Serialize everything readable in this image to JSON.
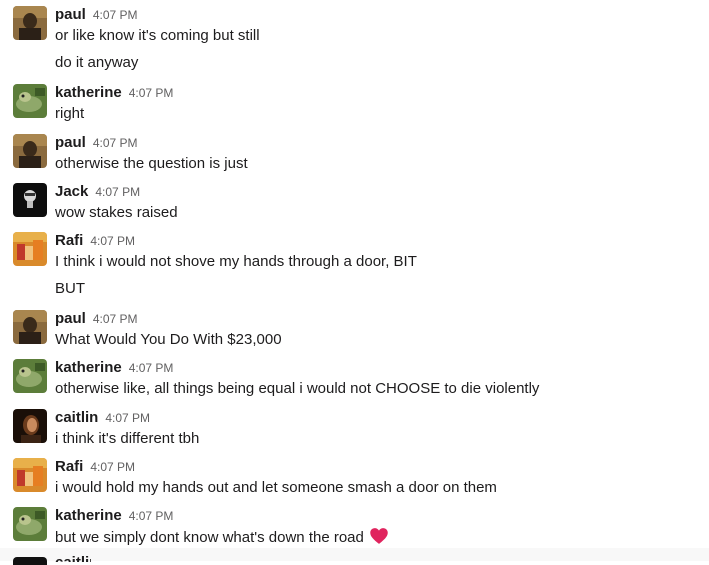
{
  "messages": [
    {
      "author": "paul",
      "time": "4:07 PM",
      "text": "or like know it's coming but still"
    },
    {
      "text": "do it anyway"
    },
    {
      "author": "katherine",
      "time": "4:07 PM",
      "text": "right"
    },
    {
      "author": "paul",
      "time": "4:07 PM",
      "text": "otherwise the question is just"
    },
    {
      "author": "Jack",
      "time": "4:07 PM",
      "text": "wow stakes raised"
    },
    {
      "author": "Rafi",
      "time": "4:07 PM",
      "text": "I think i would not shove my hands through a door, BIT"
    },
    {
      "text": "BUT"
    },
    {
      "author": "paul",
      "time": "4:07 PM",
      "text": "What Would You Do With $23,000"
    },
    {
      "author": "katherine",
      "time": "4:07 PM",
      "text": "otherwise like, all things being equal i would not CHOOSE to die violently"
    },
    {
      "author": "caitlin",
      "time": "4:07 PM",
      "text": "i think it's different tbh"
    },
    {
      "author": "Rafi",
      "time": "4:07 PM",
      "text": "i would hold my hands out and let someone smash a door on them"
    },
    {
      "author": "katherine",
      "time": "4:07 PM",
      "text": "but we simply dont know what's down the road"
    }
  ],
  "partial": {
    "author": "caitlin"
  },
  "icons": {
    "heart": "heart-emoji-icon"
  },
  "colors": {
    "author": "#1d1c1d",
    "timestamp": "#616061",
    "heart": "#e0245e"
  }
}
